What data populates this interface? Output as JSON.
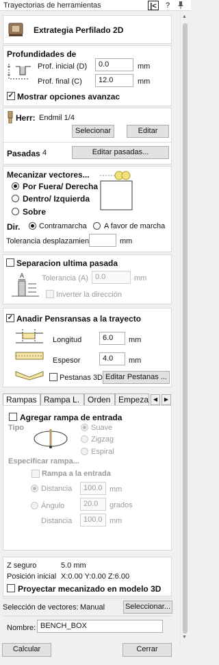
{
  "window": {
    "title": "Trayectorias de herramientas",
    "help_label": "?",
    "collapse_icon": "collapse-left-icon",
    "pin_icon": "pin-icon"
  },
  "header": {
    "title": "Extrategia Perfilado 2D",
    "icon": "profile-toolpath-icon"
  },
  "depths": {
    "heading": "Profundidades de",
    "start_label": "Prof. inicial (D)",
    "start_value": "0.0",
    "end_label": "Prof. final (C)",
    "end_value": "12.0",
    "unit": "mm",
    "show_advanced_label": "Mostrar opciones avanzac",
    "show_advanced_checked": true
  },
  "tool": {
    "label": "Herr:",
    "name": "Endmil 1/4",
    "select_label": "Selecionar",
    "edit_label": "Editar"
  },
  "passes": {
    "label": "Pasadas",
    "count": "4",
    "edit_label": "Editar pasadas..."
  },
  "machine_vectors": {
    "heading": "Mecanizar vectores...",
    "options": [
      "Por Fuera/ Derecha",
      "Dentro/ Izquierda",
      "Sobre"
    ],
    "selected": 0,
    "dir_label": "Dir.",
    "dir_options": [
      "Contramarcha",
      "A favor de marcha"
    ],
    "dir_selected": 0,
    "tolerance_label": "Tolerancia desplazamiento",
    "tolerance_value": "",
    "unit": "mm"
  },
  "last_pass": {
    "label": "Separacion ultima pasada",
    "checked": false,
    "tolerance_label": "Tolerancia (A)",
    "tolerance_value": "0.0",
    "unit": "mm",
    "invert_label": "Inverter la dirección",
    "diagram_label": "A"
  },
  "tabs_section": {
    "label": "Anadir Pensransas a la trayecto",
    "checked": true,
    "length_label": "Longitud",
    "length_value": "6.0",
    "thickness_label": "Espesor",
    "thickness_value": "4.0",
    "unit": "mm",
    "tabs3d_label": "Pestanas 3D",
    "tabs3d_checked": false,
    "edit_label": "Editar Pestanas ..."
  },
  "tab_strip": {
    "tabs": [
      "Rampas",
      "Rampa L.",
      "Orden",
      "Empeza"
    ],
    "active": 0,
    "prev_icon": "arrow-left-icon",
    "next_icon": "arrow-right-icon"
  },
  "ramps": {
    "add_label": "Agregar rampa de entrada",
    "add_checked": false,
    "type_label": "Tipo",
    "types": [
      "Suave",
      "Zigzag",
      "Espiral"
    ],
    "type_selected": 0,
    "specify_label": "Especificar rampa...",
    "entry_label": "Rampa a la entrada",
    "distance_label": "Distancia",
    "distance_value": "100.0",
    "angle_label": "Ángulo",
    "angle_value": "20.0",
    "angle_unit": "grados",
    "distance2_label": "Distancia",
    "distance2_value": "100.0",
    "unit": "mm"
  },
  "summary": {
    "safe_z_label": "Z seguro",
    "safe_z_value": "5.0 mm",
    "home_label": "Posición inicial",
    "home_value": "X:0.00 Y:0.00 Z:6.00",
    "project_label": "Proyectar mecanizado en modelo 3D",
    "project_checked": false
  },
  "selection": {
    "label": "Selección de vectores:",
    "mode": "Manual",
    "select_label": "Seleccionar..."
  },
  "name": {
    "label": "Nombre:",
    "value": "BENCH_BOX"
  },
  "footer": {
    "calculate_label": "Calcular",
    "close_label": "Cerrar"
  }
}
